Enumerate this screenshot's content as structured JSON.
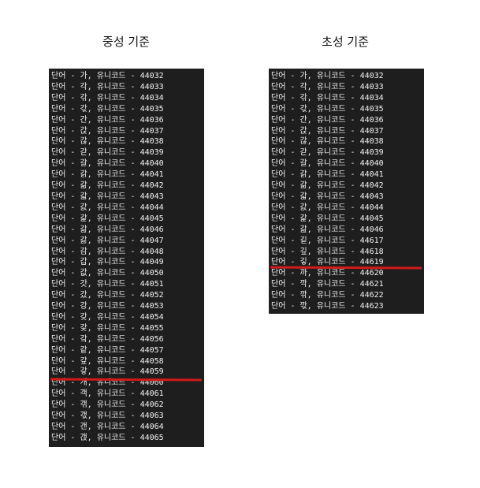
{
  "left_panel": {
    "title": "중성 기준",
    "lines": [
      "단어 - 가, 유니코드 - 44032",
      "단어 - 각, 유니코드 - 44033",
      "단어 - 갂, 유니코드 - 44034",
      "단어 - 갃, 유니코드 - 44035",
      "단어 - 간, 유니코드 - 44036",
      "단어 - 갅, 유니코드 - 44037",
      "단어 - 갆, 유니코드 - 44038",
      "단어 - 갇, 유니코드 - 44039",
      "단어 - 갈, 유니코드 - 44040",
      "단어 - 갉, 유니코드 - 44041",
      "단어 - 갊, 유니코드 - 44042",
      "단어 - 갋, 유니코드 - 44043",
      "단어 - 갌, 유니코드 - 44044",
      "단어 - 갍, 유니코드 - 44045",
      "단어 - 갎, 유니코드 - 44046",
      "단어 - 갏, 유니코드 - 44047",
      "단어 - 감, 유니코드 - 44048",
      "단어 - 갑, 유니코드 - 44049",
      "단어 - 값, 유니코드 - 44050",
      "단어 - 갓, 유니코드 - 44051",
      "단어 - 갔, 유니코드 - 44052",
      "단어 - 강, 유니코드 - 44053",
      "단어 - 갖, 유니코드 - 44054",
      "단어 - 갗, 유니코드 - 44055",
      "단어 - 갘, 유니코드 - 44056",
      "단어 - 같, 유니코드 - 44057",
      "단어 - 갚, 유니코드 - 44058",
      "단어 - 갛, 유니코드 - 44059",
      "단어 - 개, 유니코드 - 44060",
      "단어 - 객, 유니코드 - 44061",
      "단어 - 갞, 유니코드 - 44062",
      "단어 - 갟, 유니코드 - 44063",
      "단어 - 갠, 유니코드 - 44064",
      "단어 - 갡, 유니코드 - 44065"
    ]
  },
  "right_panel": {
    "title": "초성 기준",
    "lines": [
      "단어 - 가, 유니코드 - 44032",
      "단어 - 각, 유니코드 - 44033",
      "단어 - 갂, 유니코드 - 44034",
      "단어 - 갃, 유니코드 - 44035",
      "단어 - 간, 유니코드 - 44036",
      "단어 - 갅, 유니코드 - 44037",
      "단어 - 갆, 유니코드 - 44038",
      "단어 - 갇, 유니코드 - 44039",
      "단어 - 갈, 유니코드 - 44040",
      "단어 - 갉, 유니코드 - 44041",
      "단어 - 갊, 유니코드 - 44042",
      "단어 - 갋, 유니코드 - 44043",
      "단어 - 갌, 유니코드 - 44044",
      "단어 - 갍, 유니코드 - 44045",
      "단어 - 갎, 유니코드 - 44046",
      "단어 - 깉, 유니코드 - 44617",
      "단어 - 깊, 유니코드 - 44618",
      "단어 - 깋, 유니코드 - 44619",
      "단어 - 까, 유니코드 - 44620",
      "단어 - 깍, 유니코드 - 44621",
      "단어 - 깎, 유니코드 - 44622",
      "단어 - 깏, 유니코드 - 44623"
    ]
  },
  "colors": {
    "terminal_background": "#1e1e1e",
    "terminal_text": "#f2f2f2",
    "marker": "#d21a1a"
  }
}
